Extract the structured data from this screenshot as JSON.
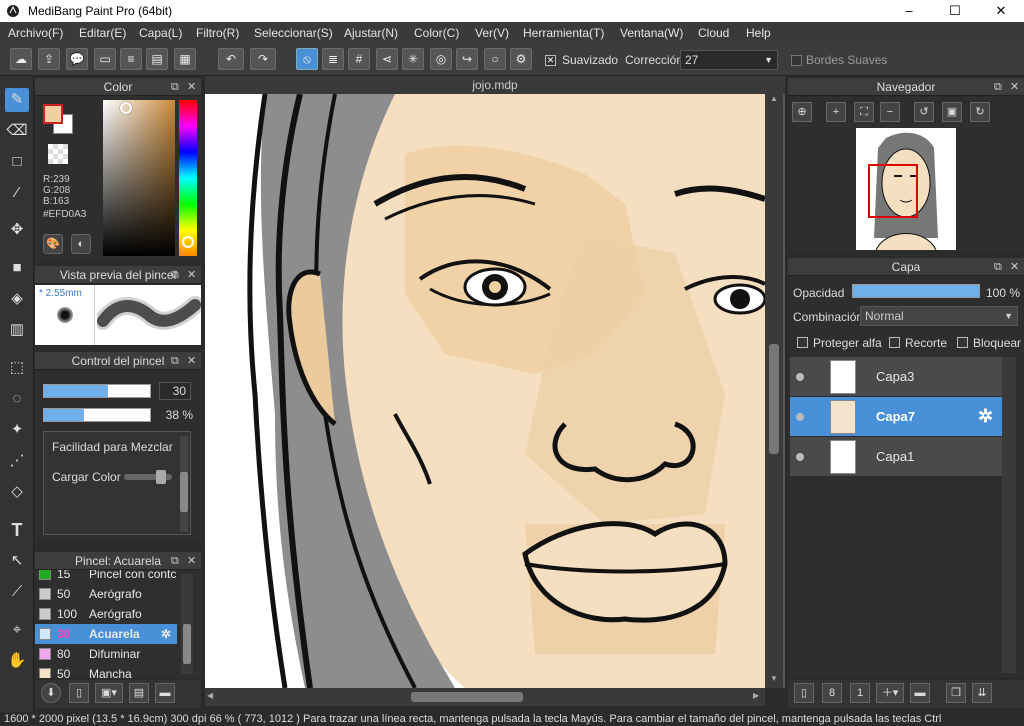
{
  "app": {
    "title": "MediBang Paint Pro (64bit)"
  },
  "menu": [
    "Archivo(F)",
    "Editar(E)",
    "Capa(L)",
    "Filtro(R)",
    "Seleccionar(S)",
    "Ajustar(N)",
    "Color(C)",
    "Ver(V)",
    "Herramienta(T)",
    "Ventana(W)",
    "Cloud",
    "Help"
  ],
  "toolbar": {
    "suavizado": "Suavizado",
    "correccion_label": "Corrección",
    "correccion_value": "27",
    "bordes": "Bordes Suaves"
  },
  "color_panel": {
    "title": "Color",
    "r": "R:239",
    "g": "G:208",
    "b": "B:163",
    "hex": "#EFD0A3",
    "fg": "#EFD0A3",
    "bg": "#ffffff"
  },
  "brush_preview": {
    "title": "Vista previa del pincel",
    "size": "* 2.55mm"
  },
  "brush_control": {
    "title": "Control del pincel",
    "size_value": "30",
    "size_fill": 0.6,
    "opacity_value": "38 %",
    "opacity_fill": 0.38,
    "mix_label": "Facilidad para Mezclar C",
    "load_label": "Cargar Color"
  },
  "brush_list": {
    "title": "Pincel: Acuarela",
    "items": [
      {
        "n": "15",
        "name": "Pincel con contc",
        "color": "#22aa22"
      },
      {
        "n": "50",
        "name": "Aerógrafo",
        "color": "#cccccc"
      },
      {
        "n": "100",
        "name": "Aerógrafo",
        "color": "#cccccc"
      },
      {
        "n": "30",
        "name": "Acuarela",
        "color": "#cfe8ff"
      },
      {
        "n": "80",
        "name": "Difuminar",
        "color": "#f0a8f0"
      },
      {
        "n": "50",
        "name": "Mancha",
        "color": "#f5e0c8"
      }
    ]
  },
  "document": {
    "tab": "jojo.mdp"
  },
  "navigator": {
    "title": "Navegador"
  },
  "layer_panel": {
    "title": "Capa",
    "opacity_label": "Opacidad",
    "opacity_value": "100 %",
    "blend_label": "Combinación",
    "blend_value": "Normal",
    "protect_alpha": "Proteger alfa",
    "clip": "Recorte",
    "lock": "Bloquear",
    "layers": [
      "Capa3",
      "Capa7",
      "Capa1"
    ]
  },
  "status": {
    "text": "1600 * 2000 pixel   (13.5 * 16.9cm)   300 dpi   66 %   ( 773, 1012 )   Para trazar una línea recta, mantenga pulsada la tecla Mayús. Para cambiar el tamaño del pincel, mantenga pulsada las teclas Ctrl"
  },
  "colors": {
    "accent": "#4a90d9",
    "skin": "#EFD0A3",
    "skin_shadow": "#E7CDA9"
  }
}
